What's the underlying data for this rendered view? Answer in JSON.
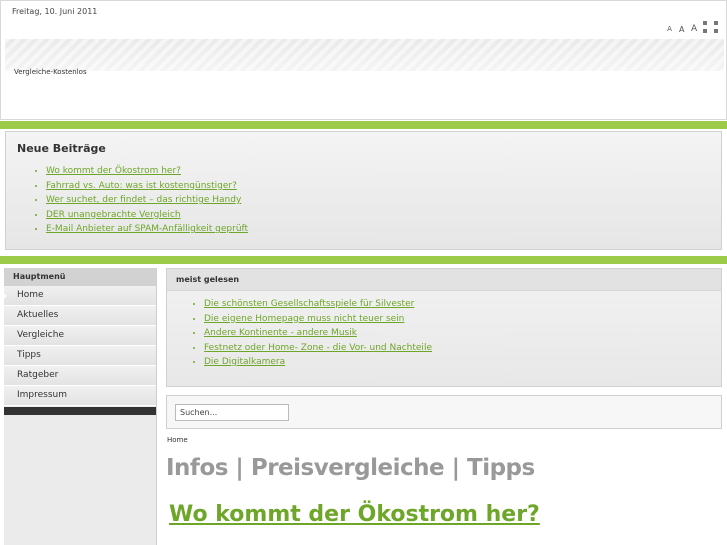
{
  "header": {
    "date": "Freitag, 10. Juni 2011",
    "site_name": "Vergleiche-Kostenlos",
    "font_tools": [
      "A",
      "A",
      "A"
    ]
  },
  "featured": {
    "title": "Neue Beiträge",
    "items": [
      "Wo kommt der Ökostrom her?",
      "Fahrrad vs. Auto: was ist kostengünstiger?",
      "Wer suchet, der findet – das richtige Handy",
      "DER unangebrachte Vergleich",
      "E-Mail Anbieter auf SPAM-Anfälligkeit geprüft"
    ]
  },
  "sidebar": {
    "title": "Hauptmenü",
    "items": [
      "Home",
      "Aktuelles",
      "Vergleiche",
      "Tipps",
      "Ratgeber",
      "Impressum"
    ]
  },
  "popular": {
    "title": "meist gelesen",
    "items": [
      "Die schönsten Gesellschaftsspiele für Silvester",
      "Die eigene Homepage muss nicht teuer sein",
      "Andere Kontinente - andere Musik",
      "Festnetz oder Home- Zone - die Vor- und Nachteile",
      "Die Digitalkamera"
    ]
  },
  "search": {
    "value": "Suchen..."
  },
  "content": {
    "breadcrumb": "Home",
    "slogan": "Infos | Preisvergleiche | Tipps",
    "headline": "Wo kommt der Ökostrom her?"
  },
  "colors": {
    "accent": "#9ccb4a",
    "link": "#6ea62a"
  }
}
